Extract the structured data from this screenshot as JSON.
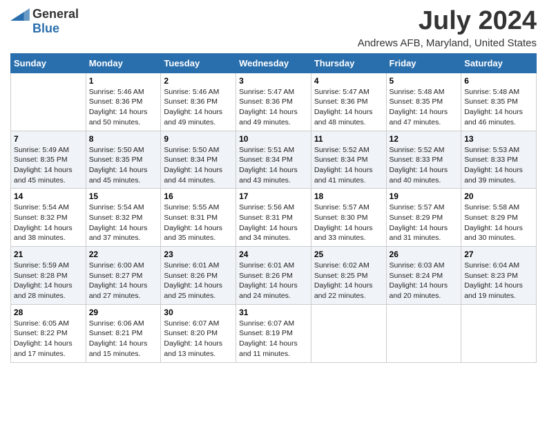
{
  "header": {
    "logo_general": "General",
    "logo_blue": "Blue",
    "month": "July 2024",
    "location": "Andrews AFB, Maryland, United States"
  },
  "weekdays": [
    "Sunday",
    "Monday",
    "Tuesday",
    "Wednesday",
    "Thursday",
    "Friday",
    "Saturday"
  ],
  "weeks": [
    [
      {
        "day": "",
        "text": ""
      },
      {
        "day": "1",
        "text": "Sunrise: 5:46 AM\nSunset: 8:36 PM\nDaylight: 14 hours\nand 50 minutes."
      },
      {
        "day": "2",
        "text": "Sunrise: 5:46 AM\nSunset: 8:36 PM\nDaylight: 14 hours\nand 49 minutes."
      },
      {
        "day": "3",
        "text": "Sunrise: 5:47 AM\nSunset: 8:36 PM\nDaylight: 14 hours\nand 49 minutes."
      },
      {
        "day": "4",
        "text": "Sunrise: 5:47 AM\nSunset: 8:36 PM\nDaylight: 14 hours\nand 48 minutes."
      },
      {
        "day": "5",
        "text": "Sunrise: 5:48 AM\nSunset: 8:35 PM\nDaylight: 14 hours\nand 47 minutes."
      },
      {
        "day": "6",
        "text": "Sunrise: 5:48 AM\nSunset: 8:35 PM\nDaylight: 14 hours\nand 46 minutes."
      }
    ],
    [
      {
        "day": "7",
        "text": "Sunrise: 5:49 AM\nSunset: 8:35 PM\nDaylight: 14 hours\nand 45 minutes."
      },
      {
        "day": "8",
        "text": "Sunrise: 5:50 AM\nSunset: 8:35 PM\nDaylight: 14 hours\nand 45 minutes."
      },
      {
        "day": "9",
        "text": "Sunrise: 5:50 AM\nSunset: 8:34 PM\nDaylight: 14 hours\nand 44 minutes."
      },
      {
        "day": "10",
        "text": "Sunrise: 5:51 AM\nSunset: 8:34 PM\nDaylight: 14 hours\nand 43 minutes."
      },
      {
        "day": "11",
        "text": "Sunrise: 5:52 AM\nSunset: 8:34 PM\nDaylight: 14 hours\nand 41 minutes."
      },
      {
        "day": "12",
        "text": "Sunrise: 5:52 AM\nSunset: 8:33 PM\nDaylight: 14 hours\nand 40 minutes."
      },
      {
        "day": "13",
        "text": "Sunrise: 5:53 AM\nSunset: 8:33 PM\nDaylight: 14 hours\nand 39 minutes."
      }
    ],
    [
      {
        "day": "14",
        "text": "Sunrise: 5:54 AM\nSunset: 8:32 PM\nDaylight: 14 hours\nand 38 minutes."
      },
      {
        "day": "15",
        "text": "Sunrise: 5:54 AM\nSunset: 8:32 PM\nDaylight: 14 hours\nand 37 minutes."
      },
      {
        "day": "16",
        "text": "Sunrise: 5:55 AM\nSunset: 8:31 PM\nDaylight: 14 hours\nand 35 minutes."
      },
      {
        "day": "17",
        "text": "Sunrise: 5:56 AM\nSunset: 8:31 PM\nDaylight: 14 hours\nand 34 minutes."
      },
      {
        "day": "18",
        "text": "Sunrise: 5:57 AM\nSunset: 8:30 PM\nDaylight: 14 hours\nand 33 minutes."
      },
      {
        "day": "19",
        "text": "Sunrise: 5:57 AM\nSunset: 8:29 PM\nDaylight: 14 hours\nand 31 minutes."
      },
      {
        "day": "20",
        "text": "Sunrise: 5:58 AM\nSunset: 8:29 PM\nDaylight: 14 hours\nand 30 minutes."
      }
    ],
    [
      {
        "day": "21",
        "text": "Sunrise: 5:59 AM\nSunset: 8:28 PM\nDaylight: 14 hours\nand 28 minutes."
      },
      {
        "day": "22",
        "text": "Sunrise: 6:00 AM\nSunset: 8:27 PM\nDaylight: 14 hours\nand 27 minutes."
      },
      {
        "day": "23",
        "text": "Sunrise: 6:01 AM\nSunset: 8:26 PM\nDaylight: 14 hours\nand 25 minutes."
      },
      {
        "day": "24",
        "text": "Sunrise: 6:01 AM\nSunset: 8:26 PM\nDaylight: 14 hours\nand 24 minutes."
      },
      {
        "day": "25",
        "text": "Sunrise: 6:02 AM\nSunset: 8:25 PM\nDaylight: 14 hours\nand 22 minutes."
      },
      {
        "day": "26",
        "text": "Sunrise: 6:03 AM\nSunset: 8:24 PM\nDaylight: 14 hours\nand 20 minutes."
      },
      {
        "day": "27",
        "text": "Sunrise: 6:04 AM\nSunset: 8:23 PM\nDaylight: 14 hours\nand 19 minutes."
      }
    ],
    [
      {
        "day": "28",
        "text": "Sunrise: 6:05 AM\nSunset: 8:22 PM\nDaylight: 14 hours\nand 17 minutes."
      },
      {
        "day": "29",
        "text": "Sunrise: 6:06 AM\nSunset: 8:21 PM\nDaylight: 14 hours\nand 15 minutes."
      },
      {
        "day": "30",
        "text": "Sunrise: 6:07 AM\nSunset: 8:20 PM\nDaylight: 14 hours\nand 13 minutes."
      },
      {
        "day": "31",
        "text": "Sunrise: 6:07 AM\nSunset: 8:19 PM\nDaylight: 14 hours\nand 11 minutes."
      },
      {
        "day": "",
        "text": ""
      },
      {
        "day": "",
        "text": ""
      },
      {
        "day": "",
        "text": ""
      }
    ]
  ]
}
